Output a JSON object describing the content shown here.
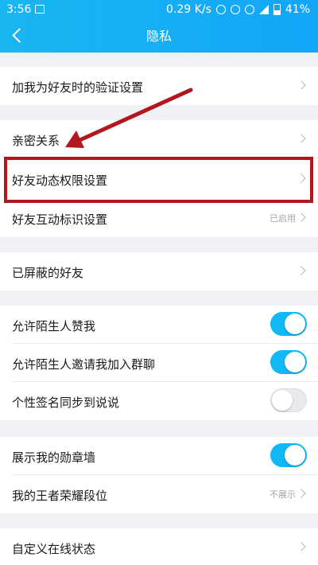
{
  "status_bar": {
    "time": "3:56",
    "speed": "0.29 K/s",
    "battery": "41%"
  },
  "nav": {
    "title": "隐私"
  },
  "rows": {
    "verify": {
      "label": "加我为好友时的验证设置"
    },
    "intimate": {
      "label": "亲密关系"
    },
    "feed_permission": {
      "label": "好友动态权限设置"
    },
    "interaction_mark": {
      "label": "好友互动标识设置",
      "value": "已启用"
    },
    "blocked": {
      "label": "已屏蔽的好友"
    },
    "stranger_like": {
      "label": "允许陌生人赞我",
      "enabled": true
    },
    "stranger_invite": {
      "label": "允许陌生人邀请我加入群聊",
      "enabled": true
    },
    "signature_sync": {
      "label": "个性签名同步到说说",
      "enabled": false
    },
    "medal_wall": {
      "label": "展示我的勋章墙",
      "enabled": true
    },
    "king_rank": {
      "label": "我的王者荣耀段位",
      "value": "不展示"
    },
    "custom_status": {
      "label": "自定义在线状态"
    }
  },
  "colors": {
    "header": "#12a6f7",
    "toggle_on": "#12b7f5",
    "annotation": "#b3171d"
  }
}
